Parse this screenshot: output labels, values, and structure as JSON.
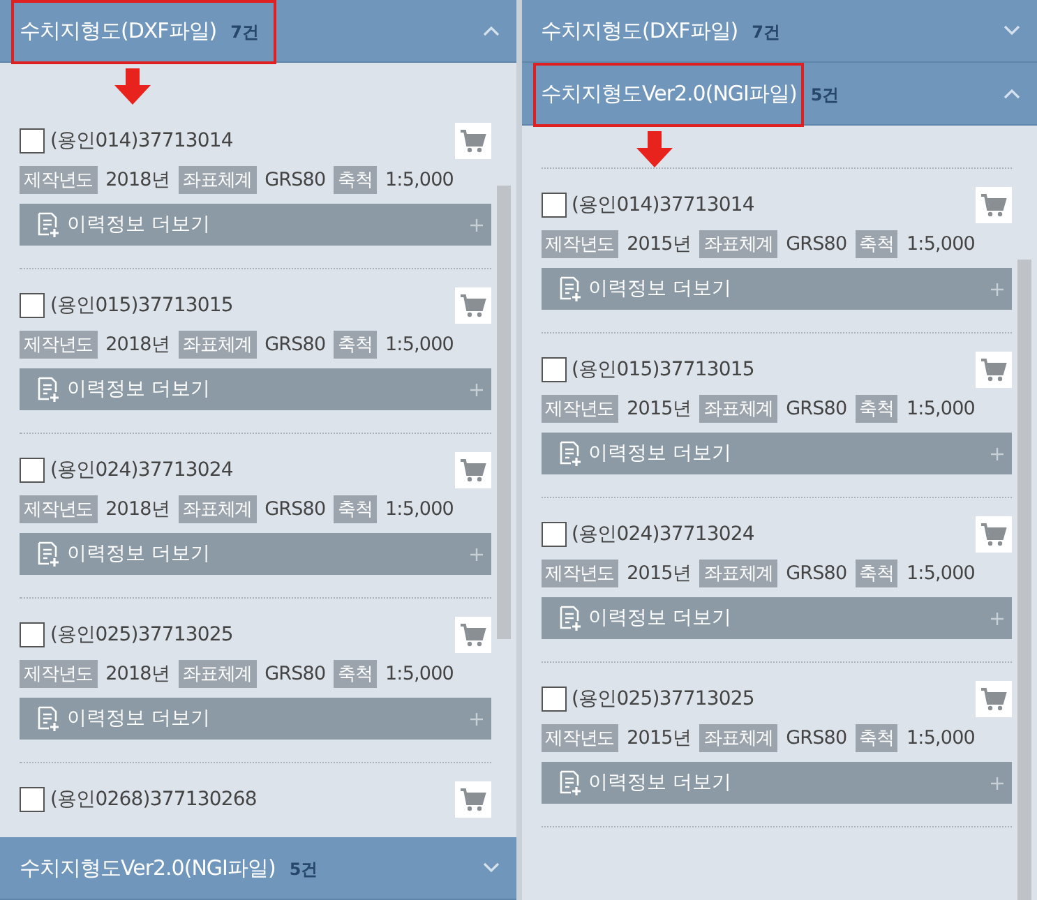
{
  "panels": [
    {
      "sections": [
        {
          "title": "수치지형도(DXF파일)",
          "count": "7건",
          "expanded": true,
          "highlighted": true,
          "items": [
            {
              "title": "(용인014)37713014",
              "checked": false,
              "meta": [
                {
                  "label": "제작년도",
                  "value": "2018년"
                },
                {
                  "label": "좌표체계",
                  "value": "GRS80"
                },
                {
                  "label": "축척",
                  "value": "1:5,000"
                }
              ],
              "more": "이력정보 더보기"
            },
            {
              "title": "(용인015)37713015",
              "checked": false,
              "meta": [
                {
                  "label": "제작년도",
                  "value": "2018년"
                },
                {
                  "label": "좌표체계",
                  "value": "GRS80"
                },
                {
                  "label": "축척",
                  "value": "1:5,000"
                }
              ],
              "more": "이력정보 더보기"
            },
            {
              "title": "(용인024)37713024",
              "checked": false,
              "meta": [
                {
                  "label": "제작년도",
                  "value": "2018년"
                },
                {
                  "label": "좌표체계",
                  "value": "GRS80"
                },
                {
                  "label": "축척",
                  "value": "1:5,000"
                }
              ],
              "more": "이력정보 더보기"
            },
            {
              "title": "(용인025)37713025",
              "checked": false,
              "meta": [
                {
                  "label": "제작년도",
                  "value": "2018년"
                },
                {
                  "label": "좌표체계",
                  "value": "GRS80"
                },
                {
                  "label": "축척",
                  "value": "1:5,000"
                }
              ],
              "more": "이력정보 더보기"
            },
            {
              "title": "(용인0268)377130268",
              "checked": false
            }
          ]
        },
        {
          "title": "수치지형도Ver2.0(NGI파일)",
          "count": "5건",
          "expanded": false,
          "highlighted": false
        }
      ]
    },
    {
      "sections": [
        {
          "title": "수치지형도(DXF파일)",
          "count": "7건",
          "expanded": false,
          "highlighted": false
        },
        {
          "title": "수치지형도Ver2.0(NGI파일)",
          "count": "5건",
          "expanded": true,
          "highlighted": true,
          "items": [
            {
              "title": "(용인014)37713014",
              "checked": false,
              "meta": [
                {
                  "label": "제작년도",
                  "value": "2015년"
                },
                {
                  "label": "좌표체계",
                  "value": "GRS80"
                },
                {
                  "label": "축척",
                  "value": "1:5,000"
                }
              ],
              "more": "이력정보 더보기"
            },
            {
              "title": "(용인015)37713015",
              "checked": false,
              "meta": [
                {
                  "label": "제작년도",
                  "value": "2015년"
                },
                {
                  "label": "좌표체계",
                  "value": "GRS80"
                },
                {
                  "label": "축척",
                  "value": "1:5,000"
                }
              ],
              "more": "이력정보 더보기"
            },
            {
              "title": "(용인024)37713024",
              "checked": false,
              "meta": [
                {
                  "label": "제작년도",
                  "value": "2015년"
                },
                {
                  "label": "좌표체계",
                  "value": "GRS80"
                },
                {
                  "label": "축척",
                  "value": "1:5,000"
                }
              ],
              "more": "이력정보 더보기"
            },
            {
              "title": "(용인025)37713025",
              "checked": false,
              "meta": [
                {
                  "label": "제작년도",
                  "value": "2015년"
                },
                {
                  "label": "좌표체계",
                  "value": "GRS80"
                },
                {
                  "label": "축척",
                  "value": "1:5,000"
                }
              ],
              "more": "이력정보 더보기"
            }
          ]
        }
      ]
    }
  ]
}
